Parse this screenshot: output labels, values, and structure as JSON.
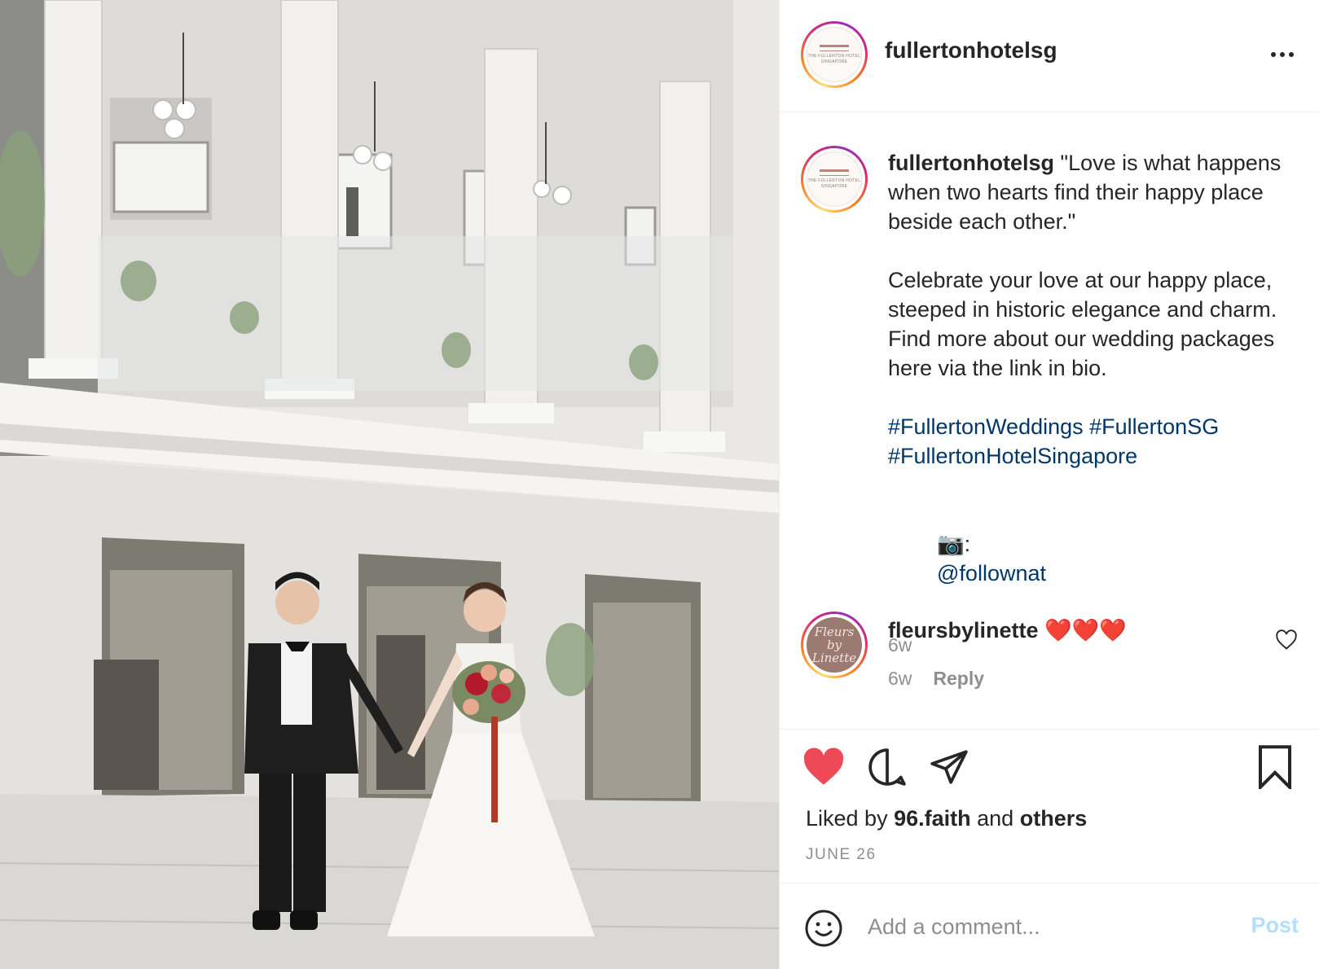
{
  "post": {
    "username": "fullertonhotelsg",
    "caption": {
      "username": "fullertonhotelsg",
      "text_line1": "\"Love is what happens when two hearts find their happy place beside each other.\"",
      "text_line2": "Celebrate your love at our happy place, steeped in historic elegance and charm. Find more about our wedding packages here via the link in bio.",
      "hashtags": "#FullertonWeddings #FullertonSG #FullertonHotelSingapore",
      "credit_icon": "📷:",
      "credit_handle": "@follownat",
      "time": "6w"
    },
    "comment": {
      "username": "fleursbylinette",
      "text": "❤️❤️❤️",
      "time": "6w",
      "reply_label": "Reply"
    },
    "likes": {
      "prefix": "Liked by",
      "user": "96.faith",
      "mid": "and",
      "others": "others"
    },
    "date": "JUNE 26",
    "add_comment": {
      "placeholder": "Add a comment...",
      "post_label": "Post"
    },
    "avatar_logo_text": "THE FULLERTON HOTEL SINGAPORE",
    "fleurs_logo_text": "Fleurs by Linette"
  },
  "colors": {
    "heart_liked": "#ed4956",
    "hashtag": "#00376b",
    "post_button": "#b2dffc",
    "muted": "#8e8e8e"
  },
  "icons": [
    "heart-icon",
    "comment-icon",
    "share-icon",
    "bookmark-icon",
    "emoji-icon",
    "more-icon",
    "comment-like-icon"
  ]
}
